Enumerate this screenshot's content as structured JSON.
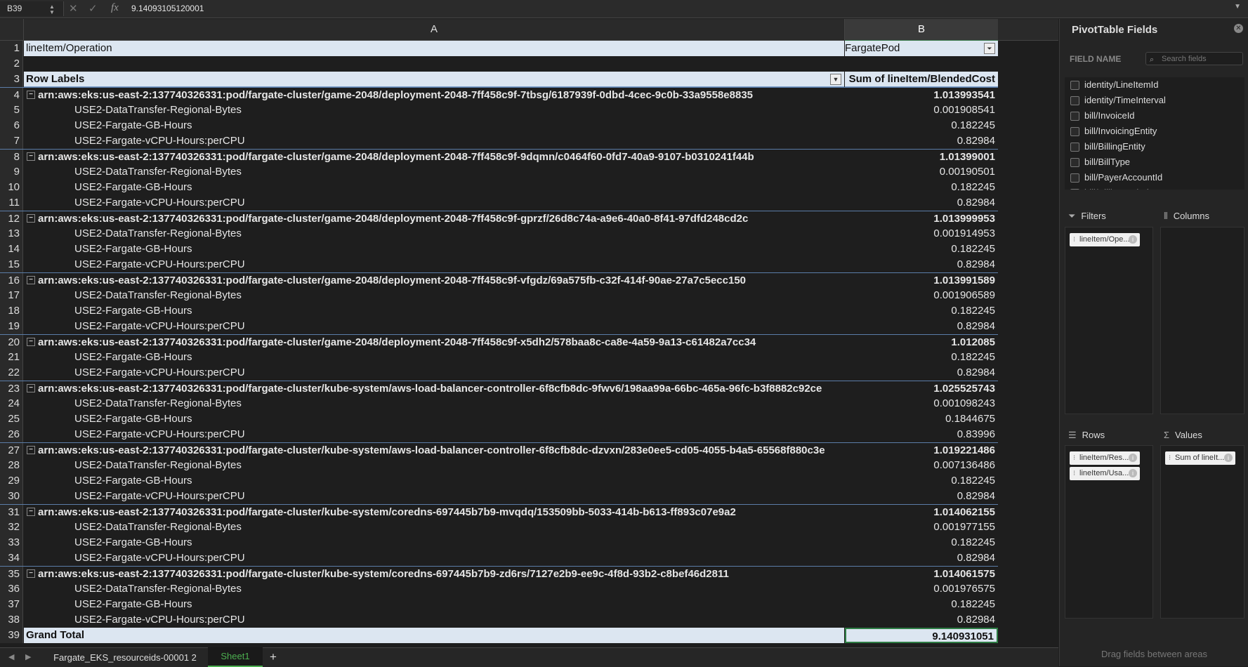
{
  "formula_bar": {
    "cell_ref": "B39",
    "fx": "fx",
    "value": "9.14093105120001"
  },
  "columns": {
    "a": "A",
    "b": "B"
  },
  "rows": [
    {
      "n": "1",
      "a": "lineItem/Operation",
      "b": "FargatePod",
      "type": "hdr"
    },
    {
      "n": "2",
      "a": "",
      "b": "",
      "type": "empty"
    },
    {
      "n": "3",
      "a": "Row Labels",
      "b": "Sum of lineItem/BlendedCost",
      "type": "lbl"
    },
    {
      "n": "4",
      "a": "arn:aws:eks:us-east-2:137740326331:pod/fargate-cluster/game-2048/deployment-2048-7ff458c9f-7tbsg/6187939f-0dbd-4cec-9c0b-33a9558e8835",
      "b": "1.013993541",
      "type": "grp"
    },
    {
      "n": "5",
      "a": "USE2-DataTransfer-Regional-Bytes",
      "b": "0.001908541",
      "type": "det"
    },
    {
      "n": "6",
      "a": "USE2-Fargate-GB-Hours",
      "b": "0.182245",
      "type": "det"
    },
    {
      "n": "7",
      "a": "USE2-Fargate-vCPU-Hours:perCPU",
      "b": "0.82984",
      "type": "det"
    },
    {
      "n": "8",
      "a": "arn:aws:eks:us-east-2:137740326331:pod/fargate-cluster/game-2048/deployment-2048-7ff458c9f-9dqmn/c0464f60-0fd7-40a9-9107-b0310241f44b",
      "b": "1.01399001",
      "type": "grp"
    },
    {
      "n": "9",
      "a": "USE2-DataTransfer-Regional-Bytes",
      "b": "0.00190501",
      "type": "det"
    },
    {
      "n": "10",
      "a": "USE2-Fargate-GB-Hours",
      "b": "0.182245",
      "type": "det"
    },
    {
      "n": "11",
      "a": "USE2-Fargate-vCPU-Hours:perCPU",
      "b": "0.82984",
      "type": "det"
    },
    {
      "n": "12",
      "a": "arn:aws:eks:us-east-2:137740326331:pod/fargate-cluster/game-2048/deployment-2048-7ff458c9f-gprzf/26d8c74a-a9e6-40a0-8f41-97dfd248cd2c",
      "b": "1.013999953",
      "type": "grp"
    },
    {
      "n": "13",
      "a": "USE2-DataTransfer-Regional-Bytes",
      "b": "0.001914953",
      "type": "det"
    },
    {
      "n": "14",
      "a": "USE2-Fargate-GB-Hours",
      "b": "0.182245",
      "type": "det"
    },
    {
      "n": "15",
      "a": "USE2-Fargate-vCPU-Hours:perCPU",
      "b": "0.82984",
      "type": "det"
    },
    {
      "n": "16",
      "a": "arn:aws:eks:us-east-2:137740326331:pod/fargate-cluster/game-2048/deployment-2048-7ff458c9f-vfgdz/69a575fb-c32f-414f-90ae-27a7c5ecc150",
      "b": "1.013991589",
      "type": "grp"
    },
    {
      "n": "17",
      "a": "USE2-DataTransfer-Regional-Bytes",
      "b": "0.001906589",
      "type": "det"
    },
    {
      "n": "18",
      "a": "USE2-Fargate-GB-Hours",
      "b": "0.182245",
      "type": "det"
    },
    {
      "n": "19",
      "a": "USE2-Fargate-vCPU-Hours:perCPU",
      "b": "0.82984",
      "type": "det"
    },
    {
      "n": "20",
      "a": "arn:aws:eks:us-east-2:137740326331:pod/fargate-cluster/game-2048/deployment-2048-7ff458c9f-x5dh2/578baa8c-ca8e-4a59-9a13-c61482a7cc34",
      "b": "1.012085",
      "type": "grp"
    },
    {
      "n": "21",
      "a": "USE2-Fargate-GB-Hours",
      "b": "0.182245",
      "type": "det"
    },
    {
      "n": "22",
      "a": "USE2-Fargate-vCPU-Hours:perCPU",
      "b": "0.82984",
      "type": "det"
    },
    {
      "n": "23",
      "a": "arn:aws:eks:us-east-2:137740326331:pod/fargate-cluster/kube-system/aws-load-balancer-controller-6f8cfb8dc-9fwv6/198aa99a-66bc-465a-96fc-b3f8882c92ce",
      "b": "1.025525743",
      "type": "grp"
    },
    {
      "n": "24",
      "a": "USE2-DataTransfer-Regional-Bytes",
      "b": "0.001098243",
      "type": "det"
    },
    {
      "n": "25",
      "a": "USE2-Fargate-GB-Hours",
      "b": "0.1844675",
      "type": "det"
    },
    {
      "n": "26",
      "a": "USE2-Fargate-vCPU-Hours:perCPU",
      "b": "0.83996",
      "type": "det"
    },
    {
      "n": "27",
      "a": "arn:aws:eks:us-east-2:137740326331:pod/fargate-cluster/kube-system/aws-load-balancer-controller-6f8cfb8dc-dzvxn/283e0ee5-cd05-4055-b4a5-65568f880c3e",
      "b": "1.019221486",
      "type": "grp"
    },
    {
      "n": "28",
      "a": "USE2-DataTransfer-Regional-Bytes",
      "b": "0.007136486",
      "type": "det"
    },
    {
      "n": "29",
      "a": "USE2-Fargate-GB-Hours",
      "b": "0.182245",
      "type": "det"
    },
    {
      "n": "30",
      "a": "USE2-Fargate-vCPU-Hours:perCPU",
      "b": "0.82984",
      "type": "det"
    },
    {
      "n": "31",
      "a": "arn:aws:eks:us-east-2:137740326331:pod/fargate-cluster/kube-system/coredns-697445b7b9-mvqdq/153509bb-5033-414b-b613-ff893c07e9a2",
      "b": "1.014062155",
      "type": "grp"
    },
    {
      "n": "32",
      "a": "USE2-DataTransfer-Regional-Bytes",
      "b": "0.001977155",
      "type": "det"
    },
    {
      "n": "33",
      "a": "USE2-Fargate-GB-Hours",
      "b": "0.182245",
      "type": "det"
    },
    {
      "n": "34",
      "a": "USE2-Fargate-vCPU-Hours:perCPU",
      "b": "0.82984",
      "type": "det"
    },
    {
      "n": "35",
      "a": "arn:aws:eks:us-east-2:137740326331:pod/fargate-cluster/kube-system/coredns-697445b7b9-zd6rs/7127e2b9-ee9c-4f8d-93b2-c8bef46d2811",
      "b": "1.014061575",
      "type": "grp"
    },
    {
      "n": "36",
      "a": "USE2-DataTransfer-Regional-Bytes",
      "b": "0.001976575",
      "type": "det"
    },
    {
      "n": "37",
      "a": "USE2-Fargate-GB-Hours",
      "b": "0.182245",
      "type": "det"
    },
    {
      "n": "38",
      "a": "USE2-Fargate-vCPU-Hours:perCPU",
      "b": "0.82984",
      "type": "det"
    },
    {
      "n": "39",
      "a": "Grand Total",
      "b": "9.140931051",
      "type": "total"
    }
  ],
  "tabs": {
    "sheet1_name": "Fargate_EKS_resourceids-00001 2",
    "sheet2_name": "Sheet1",
    "add": "+"
  },
  "pivot_pane": {
    "title": "PivotTable Fields",
    "field_name_label": "FIELD NAME",
    "search_placeholder": "Search fields",
    "fields": [
      "identity/LineItemId",
      "identity/TimeInterval",
      "bill/InvoiceId",
      "bill/InvoicingEntity",
      "bill/BillingEntity",
      "bill/BillType",
      "bill/PayerAccountId",
      "bill/BillingPeriodStartDate"
    ],
    "filters_label": "Filters",
    "columns_label": "Columns",
    "rows_label": "Rows",
    "values_label": "Values",
    "filters_items": [
      "lineItem/Ope..."
    ],
    "rows_items": [
      "lineItem/Res...",
      "lineItem/Usa..."
    ],
    "values_items": [
      "Sum of lineIt..."
    ],
    "drag_hint": "Drag fields between areas"
  }
}
